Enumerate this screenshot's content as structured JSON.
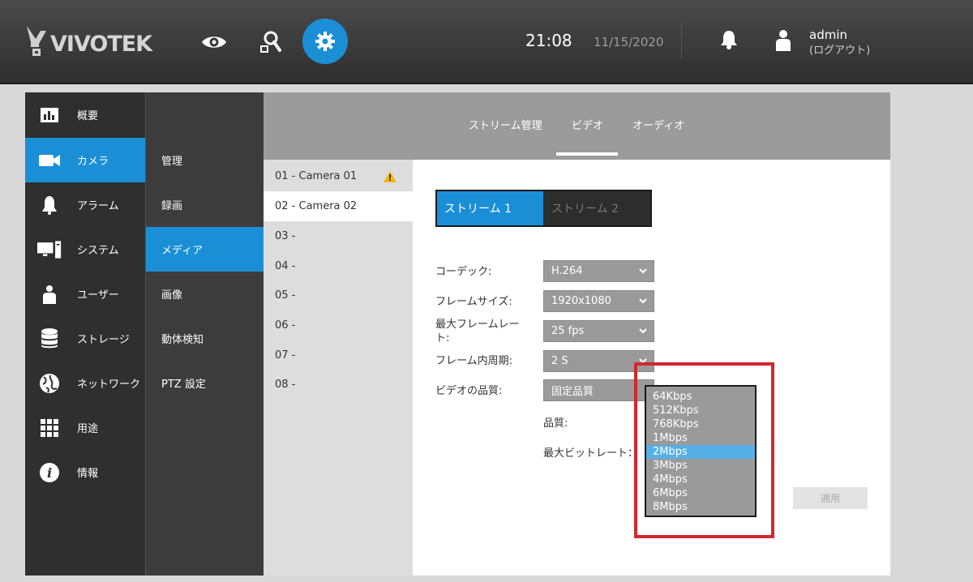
{
  "header": {
    "logo_text": "VIVOTEK",
    "time": "21:08",
    "date": "11/15/2020",
    "user": "admin",
    "logout": "(ログアウト)",
    "nav_icons": [
      "eye-icon",
      "search-icon",
      "gear-icon"
    ]
  },
  "sidebar": {
    "items": [
      {
        "label": "概要",
        "icon": "chart-icon"
      },
      {
        "label": "カメラ",
        "icon": "camera-icon"
      },
      {
        "label": "アラーム",
        "icon": "bell-icon"
      },
      {
        "label": "システム",
        "icon": "computer-icon"
      },
      {
        "label": "ユーザー",
        "icon": "user-icon"
      },
      {
        "label": "ストレージ",
        "icon": "database-icon"
      },
      {
        "label": "ネットワーク",
        "icon": "globe-icon"
      },
      {
        "label": "用途",
        "icon": "apps-grid-icon"
      },
      {
        "label": "情報",
        "icon": "info-icon"
      }
    ],
    "active_index": 1
  },
  "subnav": {
    "items": [
      "管理",
      "録画",
      "メディア",
      "画像",
      "動体検知",
      "PTZ 設定"
    ],
    "active_index": 2
  },
  "tabs": {
    "items": [
      "ストリーム管理",
      "ビデオ",
      "オーディオ"
    ],
    "active_index": 1
  },
  "cameras": {
    "items": [
      "01 - Camera 01",
      "02 - Camera 02",
      "03 -",
      "04 -",
      "05 -",
      "06 -",
      "07 -",
      "08 -"
    ],
    "active_index": 1,
    "warning_index": 0
  },
  "streams": {
    "s1": "ストリーム 1",
    "s2": "ストリーム 2"
  },
  "form": {
    "codec_label": "コーデック:",
    "codec_value": "H.264",
    "frame_size_label": "フレームサイズ:",
    "frame_size_value": "1920x1080",
    "max_fps_label": "最大フレームレート:",
    "max_fps_value": "25 fps",
    "iframe_label": "フレーム内周期:",
    "iframe_value": "2 S",
    "quality_label": "ビデオの品質:",
    "quality_value": "固定品質",
    "sub_quality_label": "品質:",
    "sub_bitrate_label": "最大ビットレート："
  },
  "bitrate_dropdown": {
    "options": [
      "64Kbps",
      "512Kbps",
      "768Kbps",
      "1Mbps",
      "2Mbps",
      "3Mbps",
      "4Mbps",
      "6Mbps",
      "8Mbps"
    ],
    "selected_index": 4
  },
  "apply_label": "適用",
  "colors": {
    "accent": "#1b8fd6",
    "highlight_box": "#d0282f",
    "dropdown_selected": "#56b0e6"
  }
}
